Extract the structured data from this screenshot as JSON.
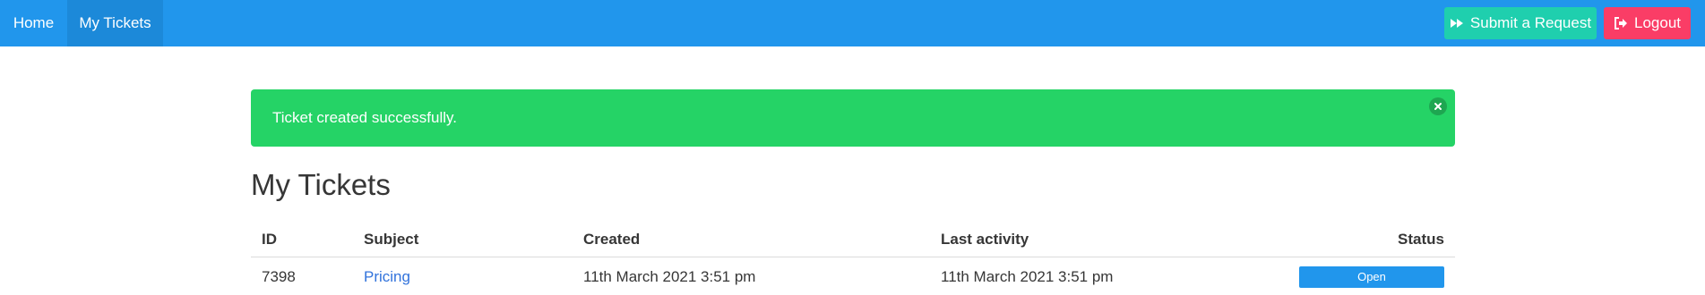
{
  "nav": {
    "items": [
      {
        "label": "Home"
      },
      {
        "label": "My Tickets"
      }
    ],
    "submit_label": "Submit a Request",
    "logout_label": "Logout"
  },
  "notification": {
    "message": "Ticket created successfully."
  },
  "page": {
    "title": "My Tickets"
  },
  "table": {
    "headers": {
      "id": "ID",
      "subject": "Subject",
      "created": "Created",
      "last_activity": "Last activity",
      "status": "Status"
    },
    "rows": [
      {
        "id": "7398",
        "subject": "Pricing",
        "created": "11th March 2021 3:51 pm",
        "last_activity": "11th March 2021 3:51 pm",
        "status": "Open"
      }
    ]
  },
  "colors": {
    "navbar": "#2196ec",
    "nav_active": "#1c89d9",
    "submit_button": "#1fcfae",
    "logout_button": "#fa3d66",
    "notification_success": "#25d366",
    "link": "#3273dc",
    "status_open": "#2196ec"
  },
  "icons": {
    "submit": "fast-forward-icon",
    "logout": "sign-out-icon",
    "notification_close": "close-icon"
  }
}
